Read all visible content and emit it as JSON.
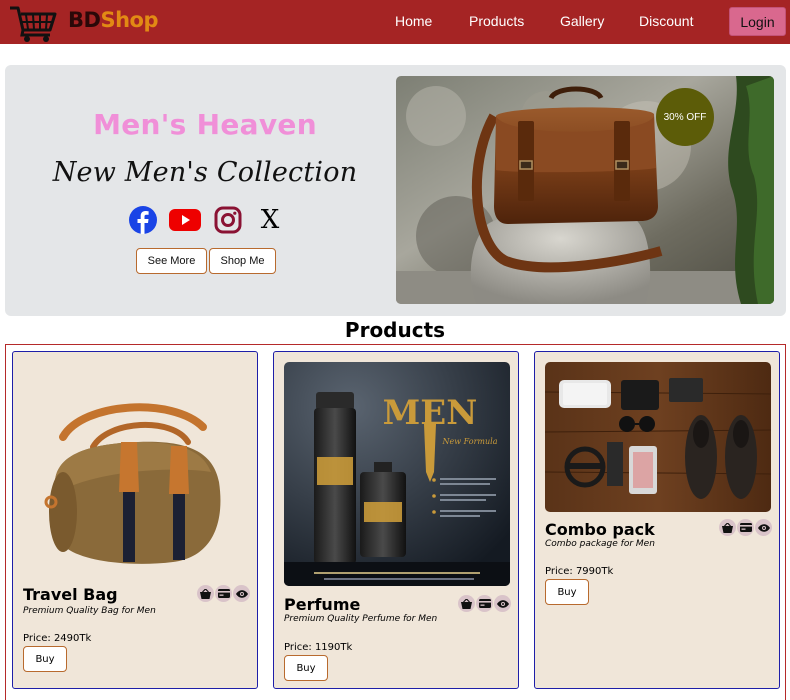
{
  "nav": {
    "brand_part1": "BD",
    "brand_part2": "Shop",
    "links": [
      "Home",
      "Products",
      "Gallery",
      "Discount"
    ],
    "login_label": "Login"
  },
  "hero": {
    "title": "Men's Heaven",
    "subtitle": "New Men's Collection",
    "socials": [
      "facebook-icon",
      "youtube-icon",
      "instagram-icon",
      "x-icon"
    ],
    "x_glyph": "X",
    "see_more_label": "See More",
    "shop_me_label": "Shop Me",
    "badge": "30% OFF"
  },
  "products_section": {
    "title": "Products",
    "items": [
      {
        "name": "Travel Bag",
        "desc": "Premium Quality Bag for Men",
        "price": "Price: 2490Tk",
        "buy_label": "Buy"
      },
      {
        "name": "Perfume",
        "desc": "Premium Quality Perfume for Men",
        "price": "Price: 1190Tk",
        "buy_label": "Buy"
      },
      {
        "name": "Combo pack",
        "desc": "Combo package for Men",
        "price": "Price: 7990Tk",
        "buy_label": "Buy"
      }
    ]
  },
  "perfume_art": {
    "headline": "MEN",
    "tagline": "New Formula"
  },
  "colors": {
    "navbar": "#a52424",
    "login_button": "#d9688e",
    "hero_bg": "#e4e6e8",
    "hero_title": "#f08fd8",
    "card_bg": "#f0e6d9",
    "card_border": "#1e1ea8",
    "badge": "#5c5c08"
  }
}
